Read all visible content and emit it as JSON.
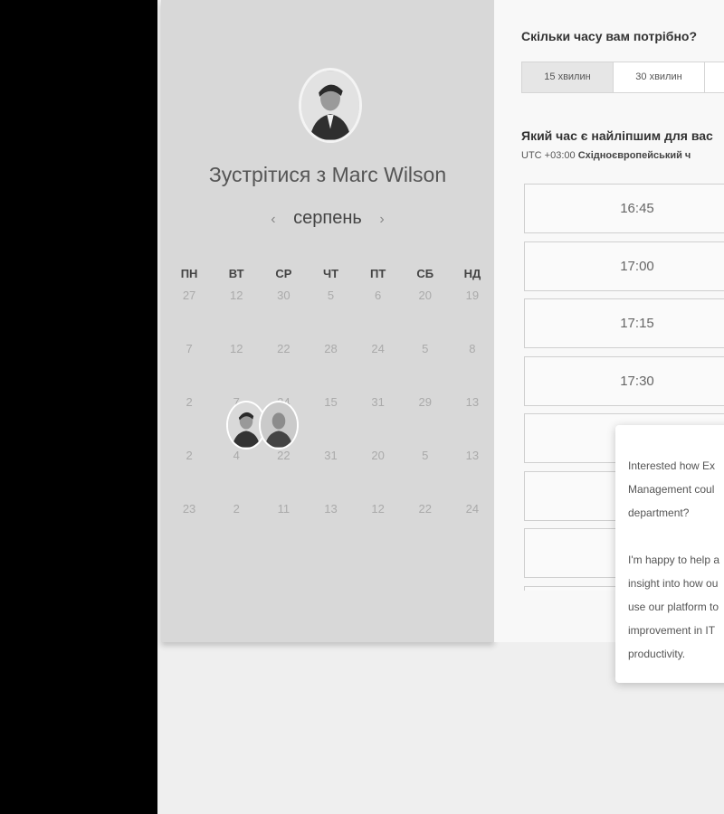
{
  "left": {
    "meet_prefix": "Зустрітися з",
    "host_name": "Marc Wilson",
    "month": "серпень",
    "prev_arrow": "‹",
    "next_arrow": "›",
    "weekdays": [
      "ПН",
      "ВТ",
      "СР",
      "ЧТ",
      "ПТ",
      "СБ",
      "НД"
    ],
    "weeks": [
      [
        "27",
        "12",
        "30",
        "5",
        "6",
        "20",
        "19"
      ],
      [
        "7",
        "12",
        "22",
        "28",
        "24",
        "5",
        "8"
      ],
      [
        "2",
        "7",
        "24",
        "15",
        "31",
        "29",
        "13"
      ],
      [
        "2",
        "4",
        "22",
        "31",
        "20",
        "5",
        "13"
      ],
      [
        "23",
        "2",
        "11",
        "13",
        "12",
        "22",
        "24"
      ]
    ]
  },
  "right": {
    "duration_question": "Скільки часу вам потрібно?",
    "durations": [
      "15 хвилин",
      "30 хвилин",
      ""
    ],
    "time_question": "Який час є найліпшим для вас",
    "tz_offset": "UTC +03:00",
    "tz_name": "Східноєвропейський ч",
    "slots": [
      "16:45",
      "17:00",
      "17:15",
      "17:30",
      "",
      "",
      "",
      ""
    ]
  },
  "chat": {
    "message": "Interested how Ex\nManagement coul\ndepartment?\n\nI'm happy to help a\ninsight into how ou\nuse our platform to\nimprovement in IT\nproductivity."
  }
}
